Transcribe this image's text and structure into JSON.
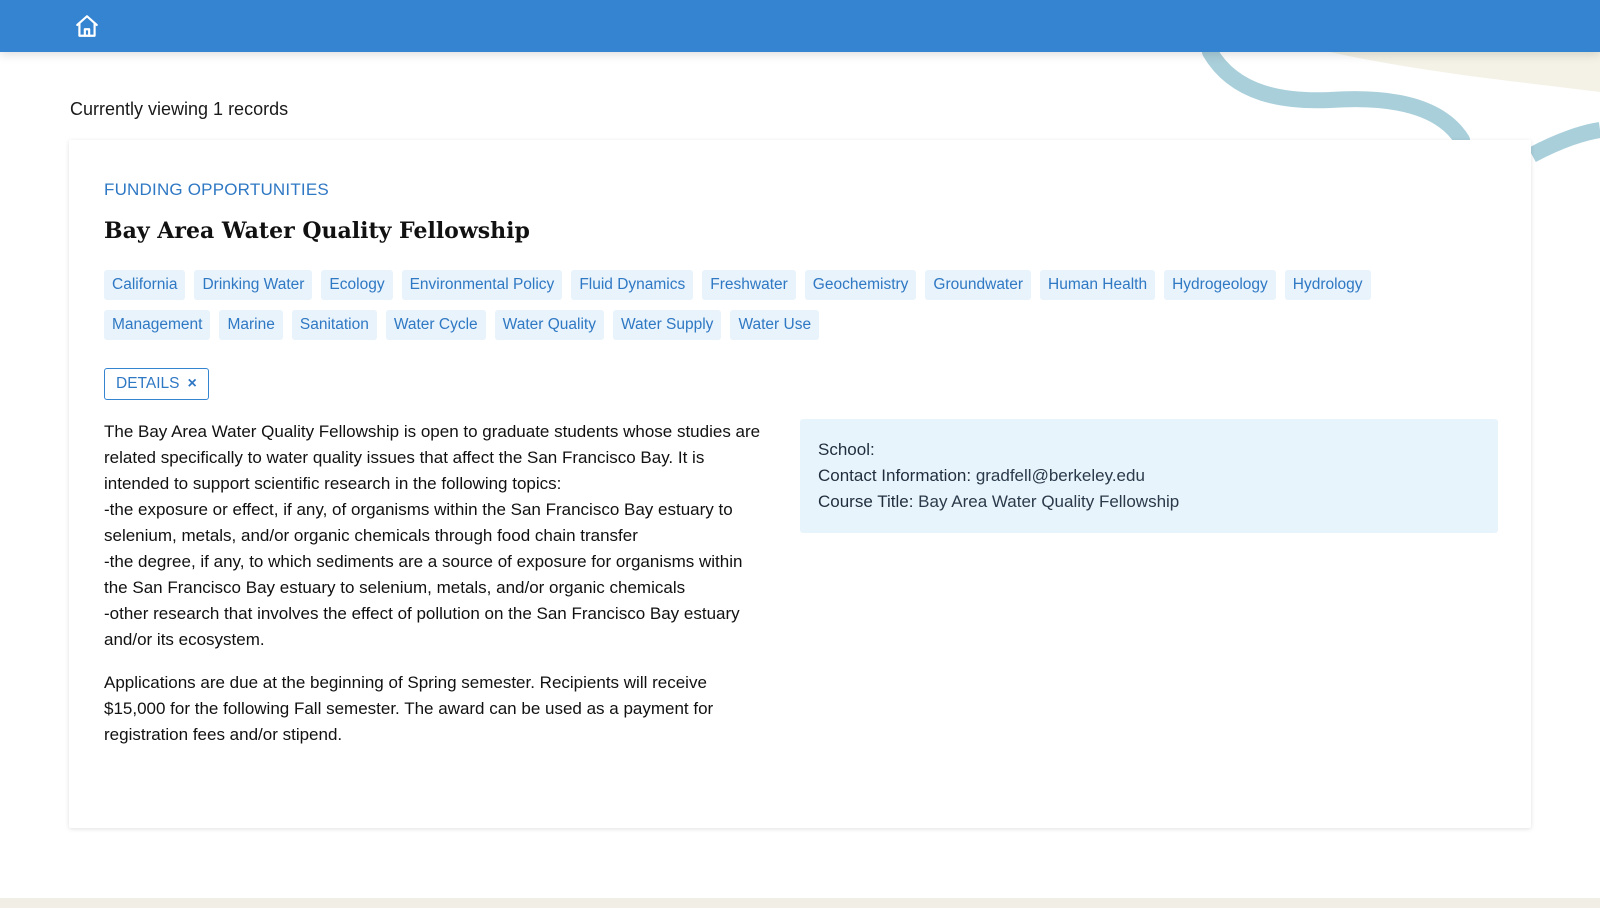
{
  "header": {
    "home_icon": "home-icon",
    "bar_color": "#3584d1"
  },
  "results": {
    "viewing_text": "Currently viewing 1 records"
  },
  "record": {
    "category": "FUNDING OPPORTUNITIES",
    "title": "Bay Area Water Quality Fellowship",
    "tags": [
      "California",
      "Drinking Water",
      "Ecology",
      "Environmental Policy",
      "Fluid Dynamics",
      "Freshwater",
      "Geochemistry",
      "Groundwater",
      "Human Health",
      "Hydrogeology",
      "Hydrology",
      "Management",
      "Marine",
      "Sanitation",
      "Water Cycle",
      "Water Quality",
      "Water Supply",
      "Water Use"
    ],
    "details_label": "DETAILS",
    "details_close_glyph": "×",
    "description": {
      "p1_lines": [
        "The Bay Area Water Quality Fellowship is open to graduate students whose studies are related specifically to water quality issues that affect the San Francisco Bay. It is intended to support scientific research in the following topics:",
        "-the exposure or effect, if any, of organisms within the San Francisco Bay estuary to selenium, metals, and/or organic chemicals through food chain transfer",
        "-the degree, if any, to which sediments are a source of exposure for organisms within the San Francisco Bay estuary to selenium, metals, and/or organic chemicals",
        "-other research that involves the effect of pollution on the San Francisco Bay estuary and/or its ecosystem."
      ],
      "p2": "Applications are due at the beginning of Spring semester. Recipients will receive $15,000 for the following Fall semester. The award can be used as a payment for registration fees and/or stipend."
    },
    "info": {
      "school_label": "School:",
      "school_value": "",
      "contact_label": "Contact Information:",
      "contact_value": "gradfell@berkeley.edu",
      "course_label": "Course Title:",
      "course_value": "Bay Area Water Quality Fellowship"
    }
  },
  "colors": {
    "accent": "#2f78c4",
    "tag_bg": "#e8f3fb",
    "info_bg": "#e8f4fc",
    "decor_wave": "#a9cfdb",
    "decor_blob": "#f4f2e6"
  }
}
